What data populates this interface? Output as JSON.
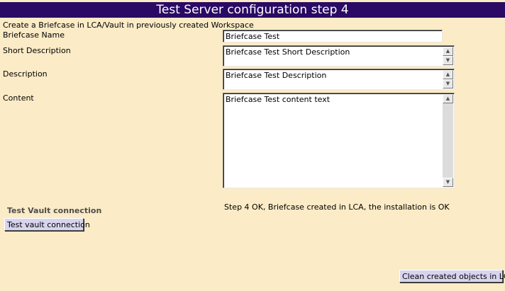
{
  "header": {
    "title": "Test Server configuration step 4"
  },
  "intro_text": "Create a Briefcase in LCA/Vault in previously created Workspace",
  "form": {
    "briefcase_name": {
      "label": "Briefcase Name",
      "value": "Briefcase Test"
    },
    "short_description": {
      "label": "Short Description",
      "value": "Briefcase Test Short Description"
    },
    "description": {
      "label": "Description",
      "value": "Briefcase Test Description"
    },
    "content": {
      "label": "Content",
      "value": "Briefcase Test content text"
    }
  },
  "status_message": "Step 4 OK, Briefcase created in LCA, the installation is OK",
  "vault_section": {
    "heading": "Test Vault connection",
    "button_label": "Test vault connection"
  },
  "clean_button_label": "Clean created objects in LCA",
  "colors": {
    "background": "#fbebc6",
    "title_bar": "#2a0a64",
    "button_face": "#d8d4ee"
  }
}
